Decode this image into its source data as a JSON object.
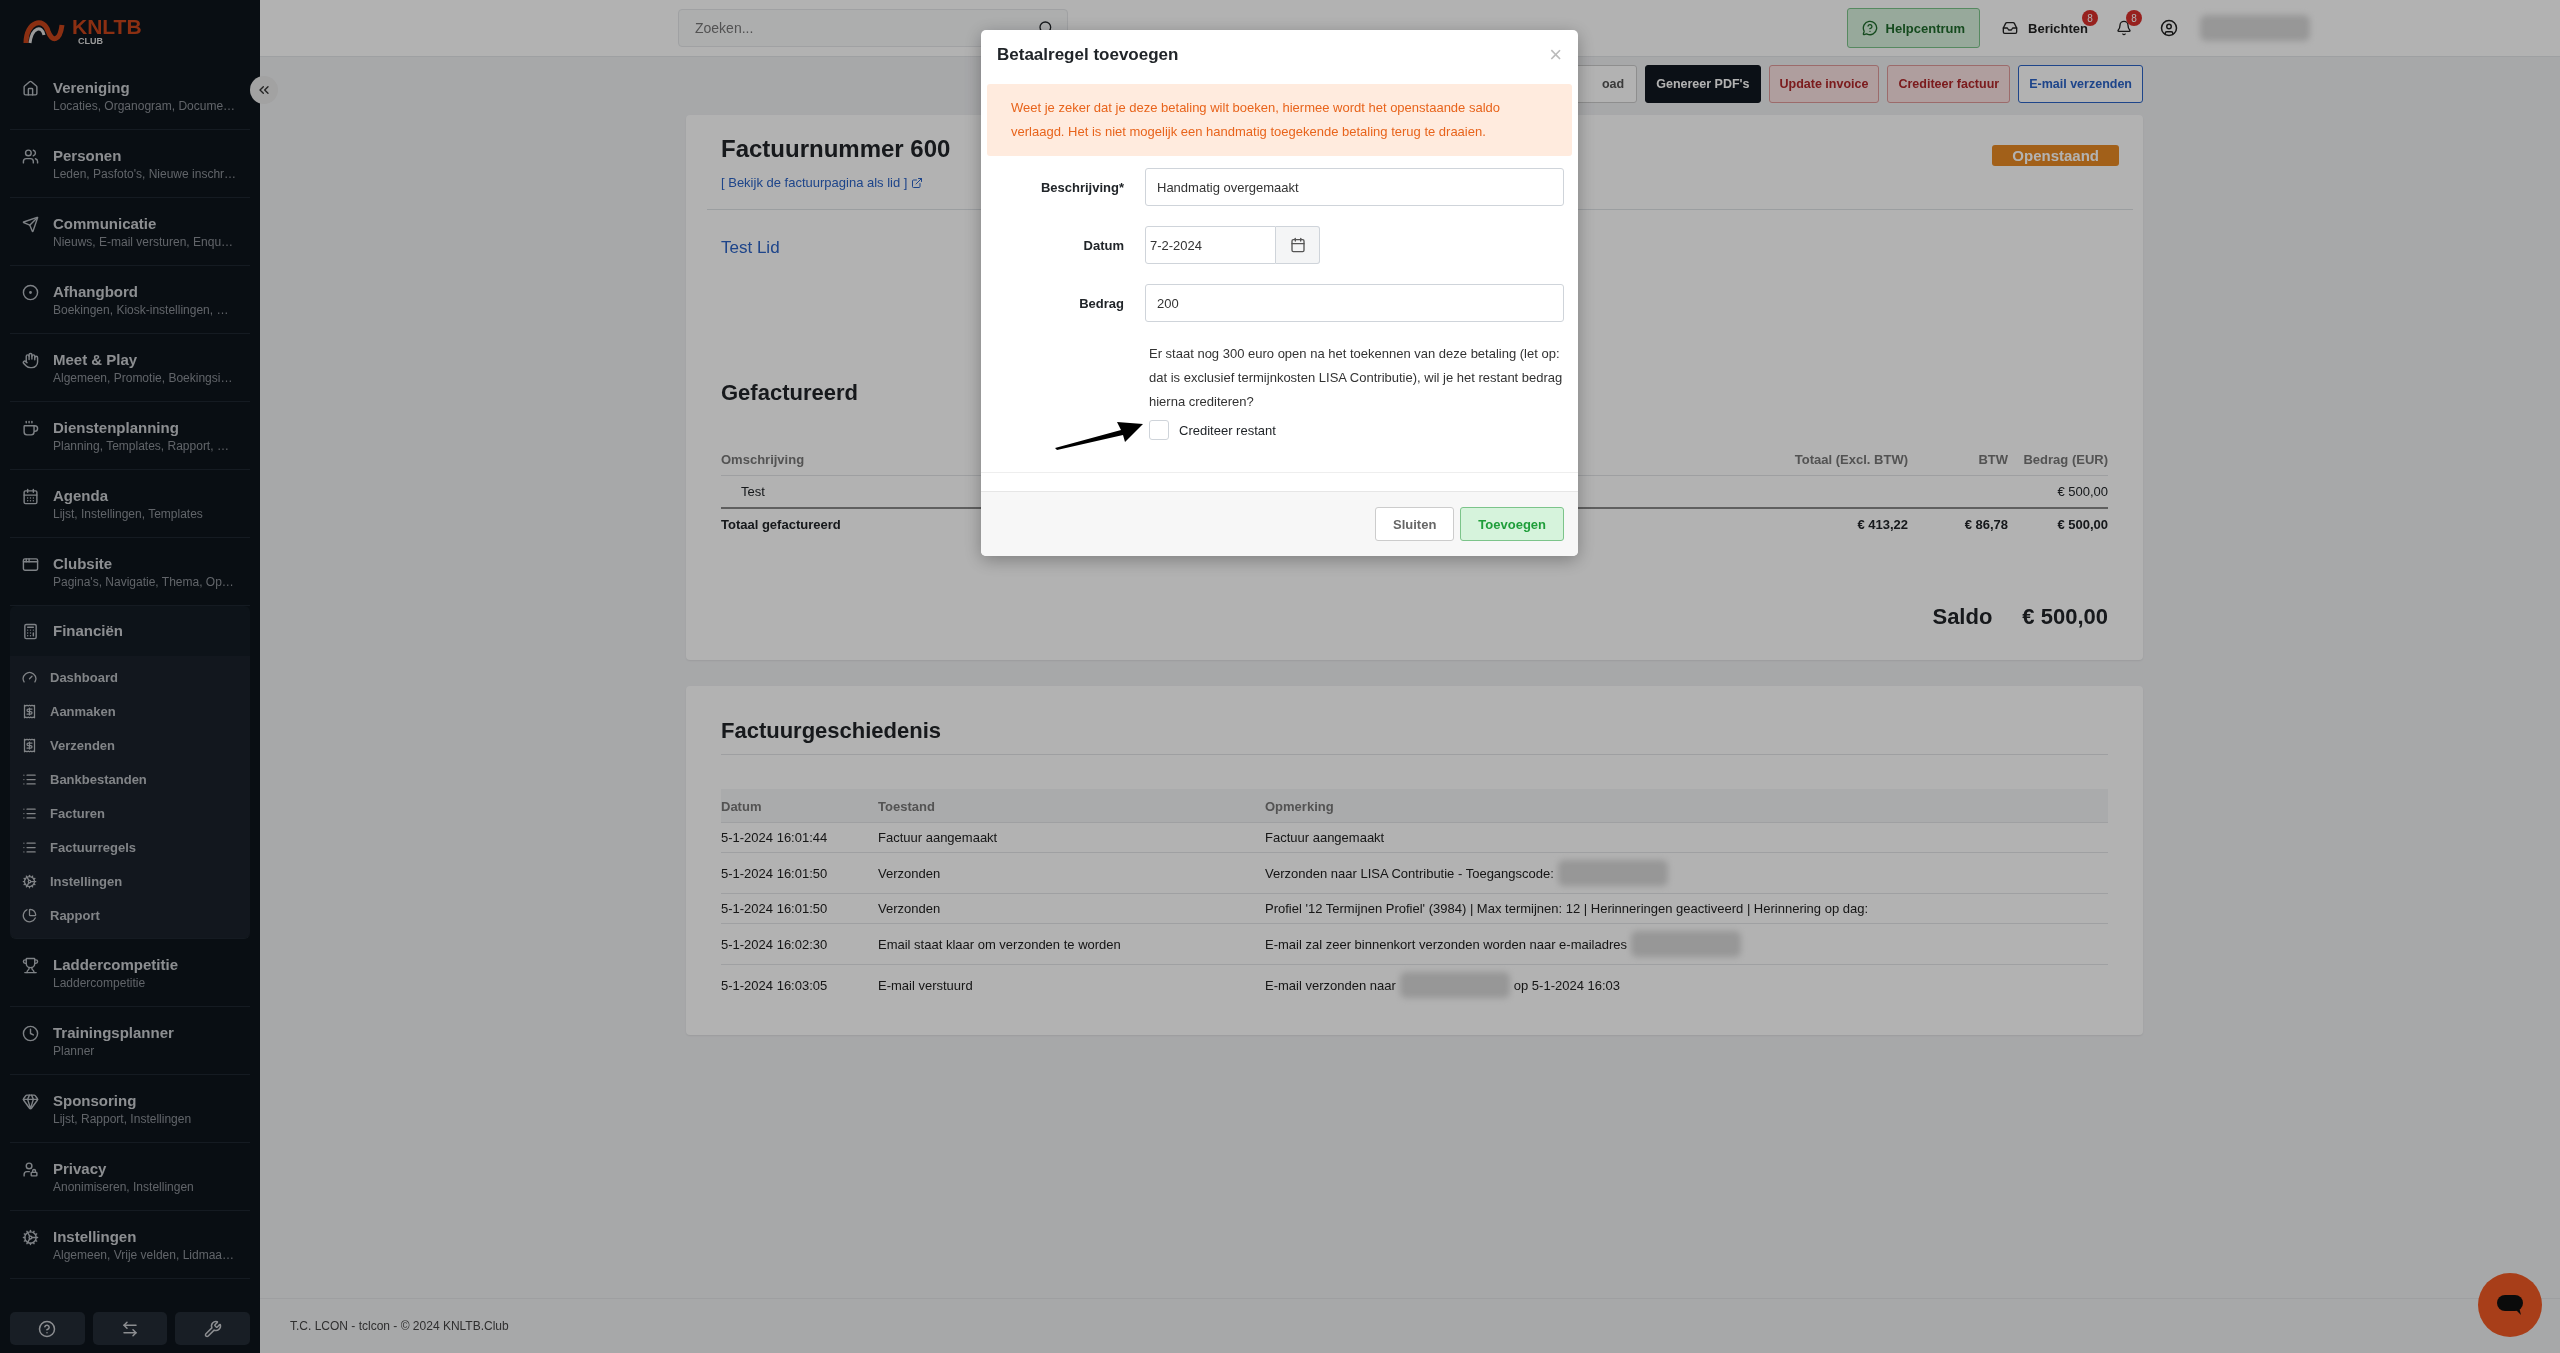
{
  "sidebar": {
    "logo": {
      "name": "KNLTB",
      "sub": "CLUB"
    },
    "groups": [
      {
        "title": "Vereniging",
        "subtitle": "Locaties, Organogram, Docume…",
        "expanded": false
      },
      {
        "title": "Personen",
        "subtitle": "Leden, Pasfoto's, Nieuwe inschr…",
        "expanded": false
      },
      {
        "title": "Communicatie",
        "subtitle": "Nieuws, E-mail versturen, Enqu…",
        "expanded": false
      },
      {
        "title": "Afhangbord",
        "subtitle": "Boekingen, Kiosk-instellingen, …",
        "expanded": false
      },
      {
        "title": "Meet & Play",
        "subtitle": "Algemeen, Promotie, Boekingsi…",
        "expanded": false
      },
      {
        "title": "Dienstenplanning",
        "subtitle": "Planning, Templates, Rapport, …",
        "expanded": false
      },
      {
        "title": "Agenda",
        "subtitle": "Lijst, Instellingen, Templates",
        "expanded": false
      },
      {
        "title": "Clubsite",
        "subtitle": "Pagina's, Navigatie, Thema, Op…",
        "expanded": false
      },
      {
        "title": "Financiën",
        "expanded": true,
        "children": [
          {
            "label": "Dashboard"
          },
          {
            "label": "Aanmaken"
          },
          {
            "label": "Verzenden"
          },
          {
            "label": "Bankbestanden"
          },
          {
            "label": "Facturen"
          },
          {
            "label": "Factuurregels"
          },
          {
            "label": "Instellingen"
          },
          {
            "label": "Rapport"
          }
        ]
      },
      {
        "title": "Laddercompetitie",
        "subtitle": "Laddercompetitie",
        "expanded": false
      },
      {
        "title": "Trainingsplanner",
        "subtitle": "Planner",
        "expanded": false
      },
      {
        "title": "Sponsoring",
        "subtitle": "Lijst, Rapport, Instellingen",
        "expanded": false
      },
      {
        "title": "Privacy",
        "subtitle": "Anonimiseren, Instellingen",
        "expanded": false
      },
      {
        "title": "Instellingen",
        "subtitle": "Algemeen, Vrije velden, Lidmaa…",
        "expanded": false
      }
    ]
  },
  "topbar": {
    "search": {
      "placeholder": "Zoeken..."
    },
    "help": "Helpcentrum",
    "messages": {
      "label": "Berichten",
      "count": "8"
    },
    "notifications": {
      "count": "8"
    }
  },
  "actions": [
    {
      "label": "oad",
      "kind": "plain"
    },
    {
      "label": "Genereer PDF's",
      "kind": "dark"
    },
    {
      "label": "Update invoice",
      "kind": "danger"
    },
    {
      "label": "Crediteer factuur",
      "kind": "danger"
    },
    {
      "label": "E-mail verzenden",
      "kind": "info"
    }
  ],
  "invoice": {
    "title": "Factuurnummer 600",
    "link": "[ Bekijk de factuurpagina als lid ]",
    "status": "Openstaand",
    "member": "Test Lid",
    "billed_heading": "Gefactureerd",
    "columns": [
      "Omschrijving",
      "Totaal (Excl. BTW)",
      "BTW",
      "Bedrag (EUR)"
    ],
    "rows": [
      [
        "Test",
        "",
        "",
        "€ 500,00"
      ]
    ],
    "total": [
      "Totaal gefactureerd",
      "€ 413,22",
      "€ 86,78",
      "€ 500,00"
    ],
    "balance_label": "Saldo",
    "balance": "€ 500,00"
  },
  "history": {
    "heading": "Factuurgeschiedenis",
    "columns": [
      "Datum",
      "Toestand",
      "Opmerking"
    ],
    "rows": [
      {
        "date": "5-1-2024 16:01:44",
        "state": "Factuur aangemaakt",
        "note": [
          {
            "kind": "text",
            "text": "Factuur aangemaakt"
          }
        ]
      },
      {
        "date": "5-1-2024 16:01:50",
        "state": "Verzonden",
        "note": [
          {
            "kind": "text",
            "text": "Verzonden naar LISA Contributie - Toegangscode:"
          },
          {
            "kind": "redacted"
          }
        ]
      },
      {
        "date": "5-1-2024 16:01:50",
        "state": "Verzonden",
        "note": [
          {
            "kind": "text",
            "text": "Profiel '12 Termijnen Profiel' (3984) | Max termijnen: 12 | Herinneringen geactiveerd | Herinnering op dag:"
          }
        ]
      },
      {
        "date": "5-1-2024 16:02:30",
        "state": "Email staat klaar om verzonden te worden",
        "note": [
          {
            "kind": "text",
            "text": "E-mail zal zeer binnenkort verzonden worden naar e-mailadres"
          },
          {
            "kind": "redacted"
          }
        ]
      },
      {
        "date": "5-1-2024 16:03:05",
        "state": "E-mail verstuurd",
        "note": [
          {
            "kind": "text",
            "text": "E-mail verzonden naar"
          },
          {
            "kind": "redacted"
          },
          {
            "kind": "text",
            "text": "op 5-1-2024 16:03"
          }
        ]
      }
    ]
  },
  "footer": "T.C. LCON - tclcon - © 2024 KNLTB.Club",
  "modal": {
    "title": "Betaalregel toevoegen",
    "close": "×",
    "alert": "Weet je zeker dat je deze betaling wilt boeken, hiermee wordt het openstaande saldo verlaagd. Het is niet mogelijk een handmatig toegekende betaling terug te draaien.",
    "fields": [
      {
        "label": "Beschrijving*",
        "value": "Handmatig overgemaakt",
        "kind": "text"
      },
      {
        "label": "Datum",
        "value": "7-2-2024",
        "kind": "date"
      },
      {
        "label": "Bedrag",
        "value": "200",
        "kind": "text"
      }
    ],
    "note": "Er staat nog 300 euro open na het toekennen van deze betaling (let op: dat is exclusief termijnkosten LISA Contributie), wil je het restant bedrag hierna crediteren?",
    "checkbox": {
      "label": "Crediteer restant",
      "checked": false
    },
    "buttons": [
      {
        "label": "Sluiten",
        "kind": "secondary"
      },
      {
        "label": "Toevoegen",
        "kind": "primary"
      }
    ]
  }
}
